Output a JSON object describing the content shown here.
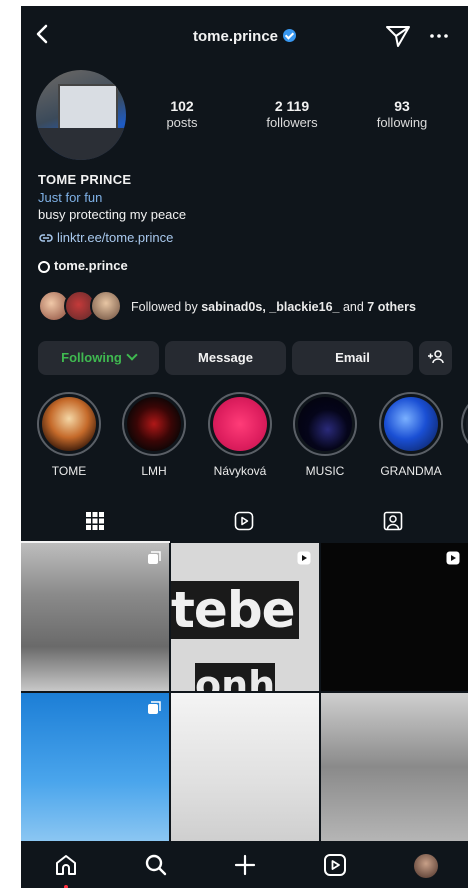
{
  "header": {
    "username": "tome.prince"
  },
  "stats": [
    {
      "value": "102",
      "label": "posts"
    },
    {
      "value": "2 119",
      "label": "followers"
    },
    {
      "value": "93",
      "label": "following"
    }
  ],
  "profile": {
    "name": "TOME PRINCE",
    "category": "Just for fun",
    "bio": "busy protecting my peace",
    "link": "linktr.ee/tome.prince",
    "threads": "tome.prince"
  },
  "followed_by": {
    "prefix": "Followed by ",
    "users": "sabinad0s, _blackie16_",
    "mid": " and ",
    "others": "7 others"
  },
  "buttons": {
    "following": "Following",
    "message": "Message",
    "email": "Email"
  },
  "highlights": [
    {
      "label": "TOME"
    },
    {
      "label": "LMH"
    },
    {
      "label": "Návyková"
    },
    {
      "label": "MUSIC"
    },
    {
      "label": "GRANDMA"
    }
  ],
  "posts": {
    "p2_text_top": "tebe",
    "p2_text_bottom": "onh"
  },
  "colors": {
    "background": "#0f151b",
    "button": "#262a31",
    "following_green": "#3fb950",
    "link_blue": "#a9c9ee",
    "verified_blue": "#3897f0"
  }
}
